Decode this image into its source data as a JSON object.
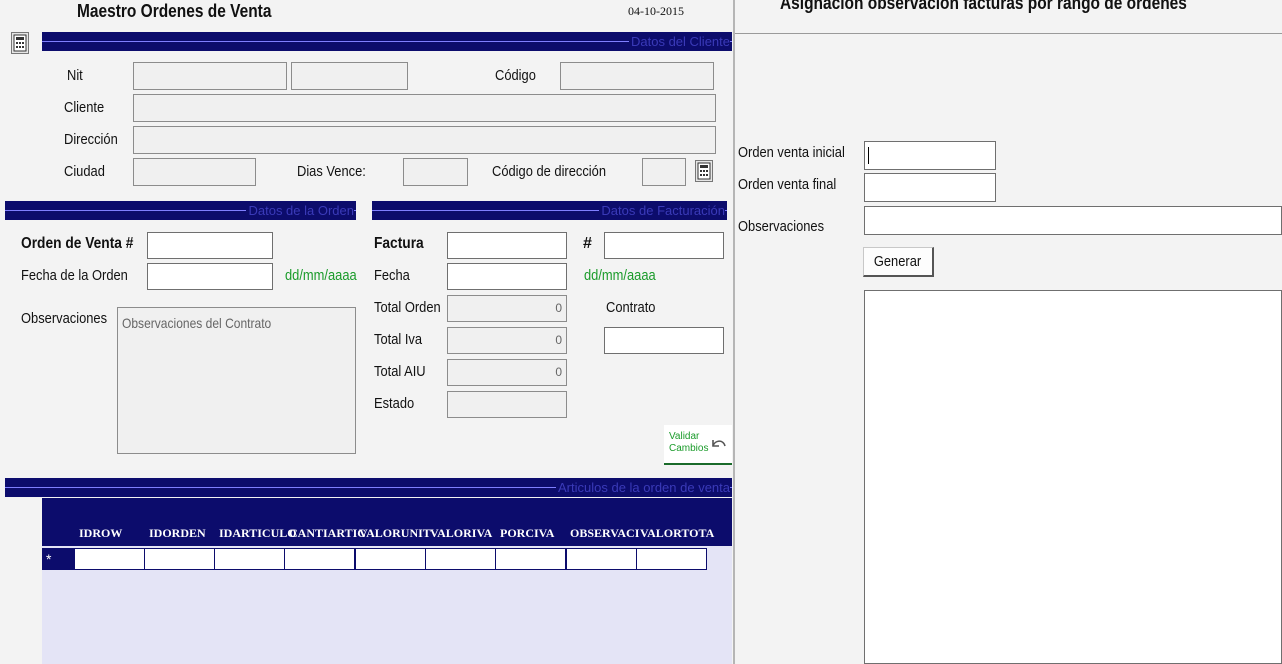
{
  "left_form": {
    "title": "Maestro Ordenes de Venta",
    "date": "04-10-2015",
    "sections": {
      "cliente": "Datos del Cliente",
      "orden": "Datos de la Orden",
      "facturacion": "Datos de Facturación",
      "articulos": "Articulos de la orden de venta"
    },
    "cliente": {
      "nit_label": "Nit",
      "codigo_label": "Código",
      "cliente_label": "Cliente",
      "direccion_label": "Dirección",
      "ciudad_label": "Ciudad",
      "dias_vence_label": "Dias Vence:",
      "codigo_direccion_label": "Código de dirección"
    },
    "orden": {
      "orden_venta_label": "Orden de Venta #",
      "fecha_label": "Fecha de la Orden",
      "fecha_hint": "dd/mm/aaaa",
      "observaciones_label": "Observaciones",
      "observaciones_value": "Observaciones del Contrato"
    },
    "facturacion": {
      "factura_label": "Factura",
      "hash_label": "#",
      "fecha_label": "Fecha",
      "fecha_hint": "dd/mm/aaaa",
      "total_orden_label": "Total Orden",
      "total_orden_value": "0",
      "contrato_label": "Contrato",
      "total_iva_label": "Total Iva",
      "total_iva_value": "0",
      "total_aiu_label": "Total AIU",
      "total_aiu_value": "0",
      "estado_label": "Estado",
      "validar_label_1": "Validar",
      "validar_label_2": "Cambios"
    },
    "grid": {
      "columns": [
        "IDROW",
        "IDORDEN",
        "IDARTICULO",
        "CANTIARTIC",
        "VALORUNIT",
        "VALORIVA",
        "PORCIVA",
        "OBSERVACI",
        "VALORTOTA"
      ],
      "new_row_marker": "*"
    }
  },
  "right_form": {
    "title": "Asignación observación facturas por rango de órdenes",
    "orden_inicial_label": "Orden venta inicial",
    "orden_final_label": "Orden venta final",
    "observaciones_label": "Observaciones",
    "generar_label": "Generar"
  }
}
